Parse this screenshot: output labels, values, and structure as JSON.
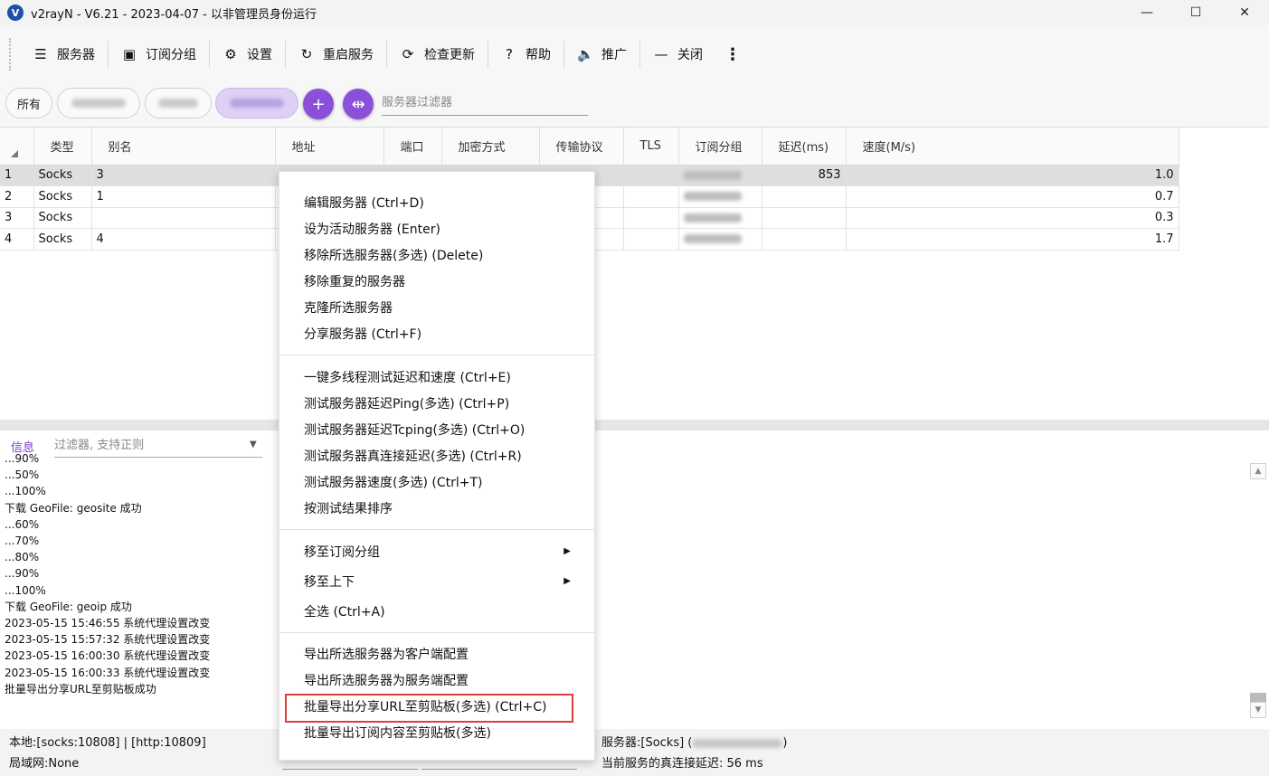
{
  "window": {
    "title": "v2rayN - V6.21 - 2023-04-07 - 以非管理员身份运行",
    "logo_letter": "V",
    "controls": {
      "minimize": "—",
      "maximize": "☐",
      "close": "✕"
    }
  },
  "toolbar": {
    "items": [
      {
        "label": "服务器",
        "icon": "server-icon",
        "glyph": "☰"
      },
      {
        "label": "订阅分组",
        "icon": "subscription-icon",
        "glyph": "▣"
      },
      {
        "label": "设置",
        "icon": "gear-icon",
        "glyph": "⚙"
      },
      {
        "label": "重启服务",
        "icon": "restart-icon",
        "glyph": "↻"
      },
      {
        "label": "检查更新",
        "icon": "update-icon",
        "glyph": "⟳"
      },
      {
        "label": "帮助",
        "icon": "help-icon",
        "glyph": "?"
      },
      {
        "label": "推广",
        "icon": "speaker-icon",
        "glyph": "🔈"
      },
      {
        "label": "关闭",
        "icon": "minus-icon",
        "glyph": "—"
      }
    ],
    "more_glyph": "⋮"
  },
  "chips": {
    "all_label": "所有",
    "add_glyph": "+",
    "sort_glyph": "⇹"
  },
  "server_filter": {
    "placeholder": "服务器过滤器"
  },
  "grid": {
    "headers": [
      "类型",
      "别名",
      "地址",
      "端口",
      "加密方式",
      "传输协议",
      "TLS",
      "订阅分组",
      "延迟(ms)",
      "速度(M/s)"
    ],
    "rows": [
      {
        "index": "1",
        "type": "Socks",
        "alias": "3",
        "delay": "853",
        "speed": "1.0"
      },
      {
        "index": "2",
        "type": "Socks",
        "alias": "1",
        "delay": "",
        "speed": "0.7"
      },
      {
        "index": "3",
        "type": "Socks",
        "alias": "",
        "delay": "",
        "speed": "0.3"
      },
      {
        "index": "4",
        "type": "Socks",
        "alias": "4",
        "delay": "",
        "speed": "1.7"
      }
    ]
  },
  "log": {
    "tab_label": "信息",
    "filter_placeholder": "过滤器, 支持正则",
    "lines": [
      "...90%",
      "...50%",
      "...100%",
      "下载 GeoFile: geosite 成功",
      "...60%",
      "...70%",
      "...80%",
      "...90%",
      "...100%",
      "下载 GeoFile: geoip 成功",
      "2023-05-15 15:46:55 系统代理设置改变",
      "2023-05-15 15:57:32 系统代理设置改变",
      "2023-05-15 16:00:30 系统代理设置改变",
      "2023-05-15 16:00:33 系统代理设置改变",
      "批量导出分享URL至剪贴板成功"
    ]
  },
  "status": {
    "local": "本地:[socks:10808] | [http:10809]",
    "lan": "局域网:None",
    "server_prefix": "服务器:[Socks] (",
    "server_suffix": ")",
    "latency": "当前服务的真连接延迟: 56 ms"
  },
  "context_menu": {
    "groups": [
      [
        "编辑服务器 (Ctrl+D)",
        "设为活动服务器 (Enter)",
        "移除所选服务器(多选) (Delete)",
        "移除重复的服务器",
        "克隆所选服务器",
        "分享服务器 (Ctrl+F)"
      ],
      [
        "一键多线程测试延迟和速度 (Ctrl+E)",
        "测试服务器延迟Ping(多选) (Ctrl+P)",
        "测试服务器延迟Tcping(多选) (Ctrl+O)",
        "测试服务器真连接延迟(多选) (Ctrl+R)",
        "测试服务器速度(多选) (Ctrl+T)",
        "按测试结果排序"
      ],
      [
        "移至订阅分组",
        "移至上下",
        "全选 (Ctrl+A)"
      ],
      [
        "导出所选服务器为客户端配置",
        "导出所选服务器为服务端配置",
        "批量导出分享URL至剪贴板(多选) (Ctrl+C)",
        "批量导出订阅内容至剪贴板(多选)"
      ]
    ],
    "submenu_glyph": "▶"
  },
  "colors": {
    "accent": "#8c4fd9",
    "chip_active": "#ddd1f6",
    "delay_red": "#d04848",
    "highlight_border": "#e03c3c"
  }
}
